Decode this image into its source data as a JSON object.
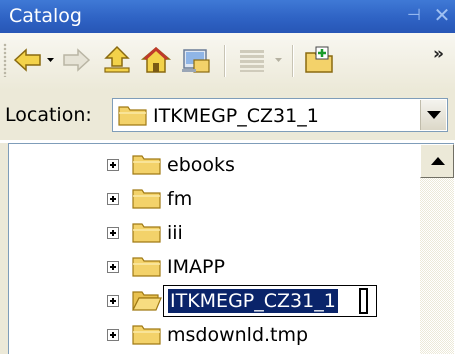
{
  "window": {
    "title": "Catalog",
    "pin_glyph": "⊣",
    "close_glyph": "✕"
  },
  "toolbar": {
    "buttons": [
      {
        "name": "back",
        "icon": "back-arrow-icon"
      },
      {
        "name": "forward",
        "icon": "forward-arrow-icon"
      },
      {
        "name": "up-one-level",
        "icon": "up-folder-icon"
      },
      {
        "name": "home",
        "icon": "home-icon"
      },
      {
        "name": "connect-folder",
        "icon": "connect-folder-icon"
      },
      {
        "name": "view-options",
        "icon": "grid-view-icon"
      },
      {
        "name": "new-folder",
        "icon": "new-folder-icon"
      }
    ],
    "overflow_glyph": "»"
  },
  "location": {
    "label": "Location:",
    "value": "ITKMEGP_CZ31_1"
  },
  "tree": {
    "items": [
      {
        "label": "ebooks",
        "editing": false
      },
      {
        "label": "fm",
        "editing": false
      },
      {
        "label": "iii",
        "editing": false
      },
      {
        "label": "IMAPP",
        "editing": false
      },
      {
        "label": "ITKMEGP_CZ31_1",
        "editing": true
      },
      {
        "label": "msdownld.tmp",
        "editing": false
      }
    ]
  },
  "colors": {
    "titlebar": "#2f63c4",
    "toolbar": "#ece9d8",
    "folder": "#f3d26a",
    "selection": "#0a246a"
  }
}
